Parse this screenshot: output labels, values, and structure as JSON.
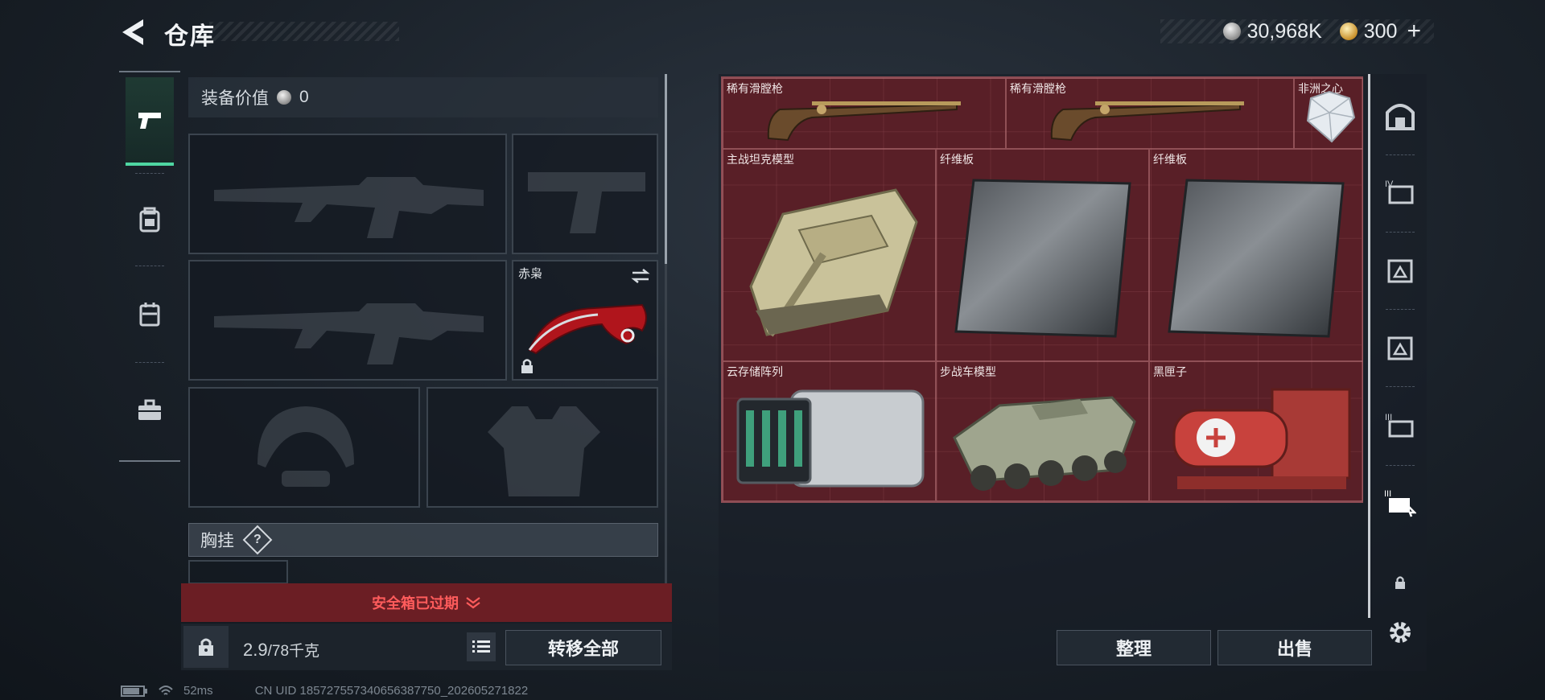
{
  "header": {
    "title": "仓库",
    "currencies": [
      {
        "name": "silver-coin",
        "value": "30,968K"
      },
      {
        "name": "gold-coin",
        "value": "300"
      }
    ],
    "plus_label": "+"
  },
  "left_tabs": [
    {
      "icon": "pistol-icon",
      "active": true
    },
    {
      "icon": "backpack-icon",
      "active": false
    },
    {
      "icon": "chest-rig-icon",
      "active": false
    },
    {
      "icon": "briefcase-icon",
      "active": false
    }
  ],
  "equipment": {
    "value_label": "装备价值",
    "value": "0",
    "melee_slot_label": "赤枭",
    "chest_label": "胸挂",
    "help_label": "?"
  },
  "safebox": {
    "expired_text": "安全箱已过期",
    "weight_current": "2.9",
    "weight_max": "/78千克",
    "transfer_all": "转移全部"
  },
  "storage": {
    "items": [
      {
        "label": "稀有滑膛枪",
        "kind": "musket"
      },
      {
        "label": "稀有滑膛枪",
        "kind": "musket"
      },
      {
        "label": "非洲之心",
        "kind": "diamond"
      },
      {
        "label": "主战坦克模型",
        "kind": "tank"
      },
      {
        "label": "纤维板",
        "kind": "panel"
      },
      {
        "label": "纤维板",
        "kind": "panel"
      },
      {
        "label": "云存储阵列",
        "kind": "server"
      },
      {
        "label": "步战车模型",
        "kind": "ifv"
      },
      {
        "label": "黑匣子",
        "kind": "blackbox"
      }
    ],
    "sort_label": "整理",
    "sell_label": "出售"
  },
  "right_rail": [
    "safe-room-icon",
    "folder-1-icon",
    "folder-2-icon",
    "folder-3-icon",
    "folder-4-icon",
    "folder-5-icon",
    "lock-icon",
    "settings-icon"
  ],
  "status_bar": {
    "ping": "52ms",
    "uid": "CN UID 185727557340656387750_202605271822"
  },
  "colors": {
    "accent": "#4fd6a2",
    "danger": "#ff5c5c",
    "grid_bg": "#5a2128"
  }
}
